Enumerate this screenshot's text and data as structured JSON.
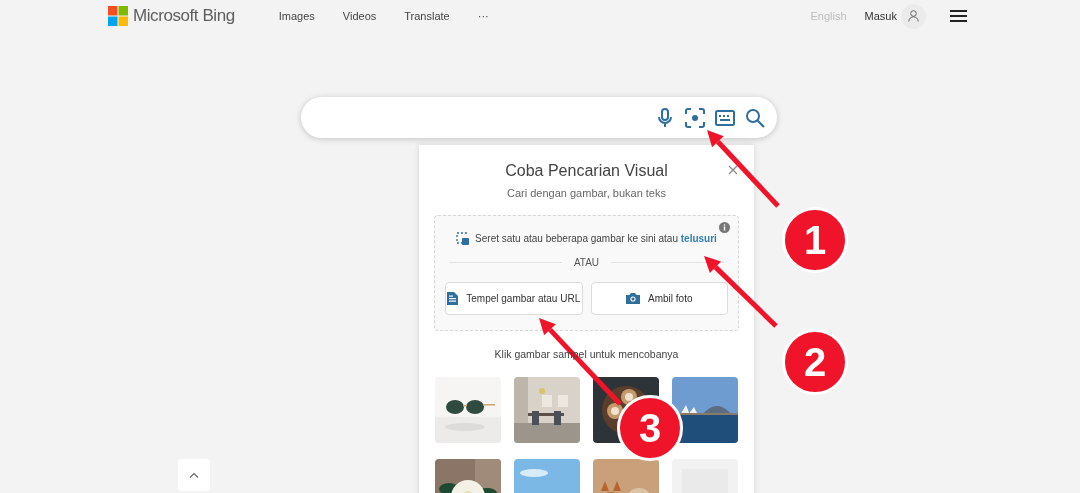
{
  "header": {
    "logo": "Microsoft Bing",
    "nav": [
      "Images",
      "Videos",
      "Translate",
      "···"
    ],
    "language": "English",
    "sign_in": "Masuk"
  },
  "visual_search": {
    "title": "Coba Pencarian Visual",
    "subtitle": "Cari dengan gambar, bukan teks",
    "drop_text": "Seret satu atau beberapa gambar ke sini atau",
    "browse_link": "telusuri",
    "divider": "ATAU",
    "buttons": [
      {
        "kind": "paste",
        "label": "Tempel gambar atau URL"
      },
      {
        "kind": "camera",
        "label": "Ambil foto"
      }
    ],
    "sample_hint": "Klik gambar sampel untuk mencobanya"
  },
  "annotations": [
    {
      "label": "1"
    },
    {
      "label": "2"
    },
    {
      "label": "3"
    }
  ]
}
